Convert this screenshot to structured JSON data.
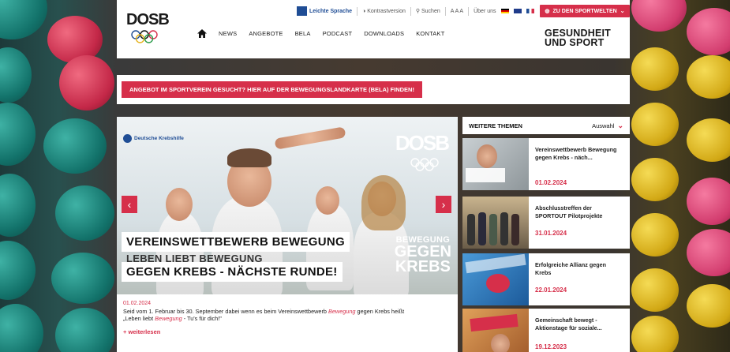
{
  "header": {
    "logo_left": "DOSB",
    "logo_right_line1": "GESUNDHEIT",
    "logo_right_line2": "UND SPORT",
    "nav": [
      "NEWS",
      "ANGEBOTE",
      "BELA",
      "PODCAST",
      "DOWNLOADS",
      "KONTAKT"
    ],
    "util": {
      "leichte_sprache": "Leichte Sprache",
      "kontrast": "Kontrastversion",
      "suche": "Suchen",
      "fontsize": "A A A",
      "ueber": "Über uns"
    },
    "cta_label": "ZU DEN SPORTWELTEN"
  },
  "banner": {
    "label": "ANGEBOT IM SPORTVEREIN GESUCHT? HIER AUF DER BEWEGUNGSLANDKARTE (BELA) FINDEN!"
  },
  "hero": {
    "krebshilfe": "Deutsche Krebshilfe",
    "dosb": "DOSB",
    "title_line1": "VEREINSWETTBEWERB BEWEGUNG",
    "title_line2": "LEBEN LIEBT BEWEGUNG",
    "title_line3": "GEGEN KREBS - NÄCHSTE RUNDE!",
    "badge_l1": "BEWEGUNG",
    "badge_l2": "GEGEN",
    "badge_l3": "KREBS",
    "prev": "‹",
    "next": "›"
  },
  "article": {
    "date": "01.02.2024",
    "excerpt_a": "Seid vom 1. Februar bis 30. September dabei wenn es beim Vereinswettbewerb ",
    "excerpt_em1": "Bewegung",
    "excerpt_b": " gegen Krebs heißt",
    "excerpt_c": "„Leben liebt ",
    "excerpt_em2": "Bewegung",
    "excerpt_d": " - Tu's für dich!\"",
    "more": "weiterlesen"
  },
  "sidebar": {
    "title": "WEITERE THEMEN",
    "select": "Auswahl",
    "cards": [
      {
        "title": "Vereinswettbewerb Bewegung gegen Krebs - näch...",
        "date": "01.02.2024"
      },
      {
        "title": "Abschlusstreffen der SPORTOUT Pilotprojekte",
        "date": "31.01.2024"
      },
      {
        "title": "Erfolgreiche Allianz gegen Krebs",
        "date": "22.01.2024"
      },
      {
        "title": "Gemeinschaft bewegt - Aktionstage für soziale...",
        "date": "19.12.2023"
      }
    ]
  },
  "colors": {
    "accent": "#d62f4a",
    "blue": "#1f4d95"
  }
}
